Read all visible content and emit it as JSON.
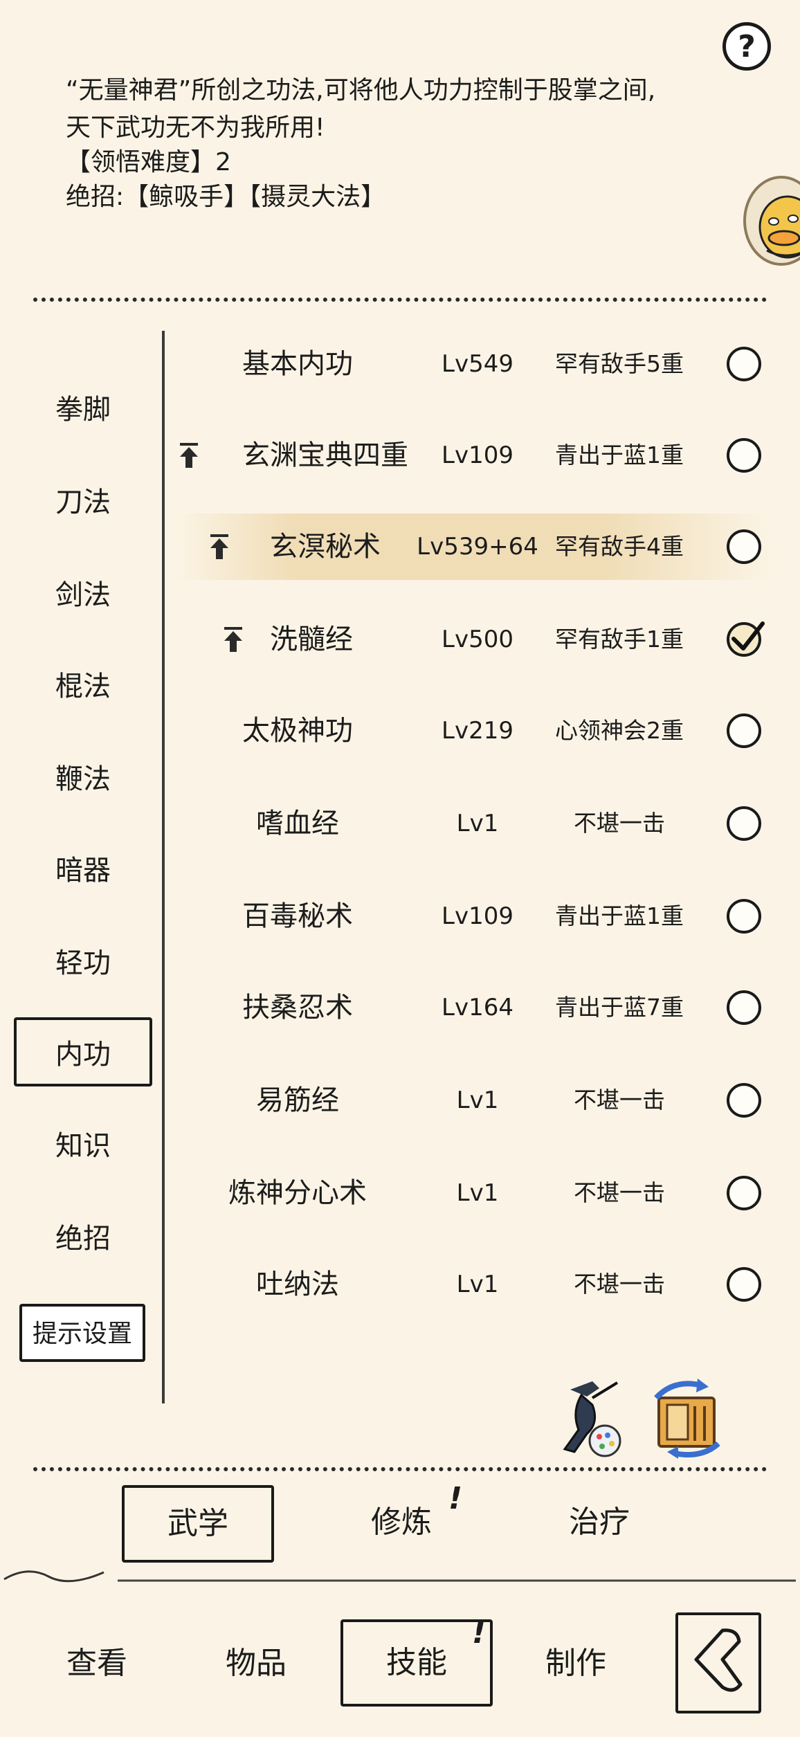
{
  "description": {
    "line1": "“无量神君”所创之功法,可将他人功力控制于股掌之间,",
    "line2": "天下武功无不为我所用!",
    "line3": "【领悟难度】2",
    "line4": "绝招:【鲸吸手】【摄灵大法】"
  },
  "help_label": "?",
  "categories": [
    "拳脚",
    "刀法",
    "剑法",
    "棍法",
    "鞭法",
    "暗器",
    "轻功",
    "内功",
    "知识",
    "绝招"
  ],
  "active_category": "内功",
  "hint_settings_label": "提示设置",
  "skills": [
    {
      "name": "基本内功",
      "level": "Lv549",
      "rank": "罕有敌手5重",
      "upgrade": false,
      "checked": false
    },
    {
      "name": "玄渊宝典四重",
      "level": "Lv109",
      "rank": "青出于蓝1重",
      "upgrade": true,
      "checked": false
    },
    {
      "name": "玄溟秘术",
      "level": "Lv539+64",
      "rank": "罕有敌手4重",
      "upgrade": true,
      "checked": false,
      "highlighted": true
    },
    {
      "name": "洗髓经",
      "level": "Lv500",
      "rank": "罕有敌手1重",
      "upgrade": true,
      "checked": true
    },
    {
      "name": "太极神功",
      "level": "Lv219",
      "rank": "心领神会2重",
      "upgrade": false,
      "checked": false
    },
    {
      "name": "嗜血经",
      "level": "Lv1",
      "rank": "不堪一击",
      "upgrade": false,
      "checked": false
    },
    {
      "name": "百毒秘术",
      "level": "Lv109",
      "rank": "青出于蓝1重",
      "upgrade": false,
      "checked": false
    },
    {
      "name": "扶桑忍术",
      "level": "Lv164",
      "rank": "青出于蓝7重",
      "upgrade": false,
      "checked": false
    },
    {
      "name": "易筋经",
      "level": "Lv1",
      "rank": "不堪一击",
      "upgrade": false,
      "checked": false
    },
    {
      "name": "炼神分心术",
      "level": "Lv1",
      "rank": "不堪一击",
      "upgrade": false,
      "checked": false
    },
    {
      "name": "吐纳法",
      "level": "Lv1",
      "rank": "不堪一击",
      "upgrade": false,
      "checked": false
    }
  ],
  "sub_tabs": {
    "martial": "武学",
    "cultivate": "修炼",
    "heal": "治疗",
    "alert": "!"
  },
  "bottom_nav": {
    "view": "查看",
    "items": "物品",
    "skills": "技能",
    "craft": "制作",
    "alert": "!"
  },
  "icons": {
    "help": "question-icon",
    "avatar": "duck-avatar-icon",
    "upgrade": "up-arrow-icon",
    "swordsman": "swordsman-palette-icon",
    "manual": "manual-swap-icon",
    "back": "back-arrow-icon"
  }
}
